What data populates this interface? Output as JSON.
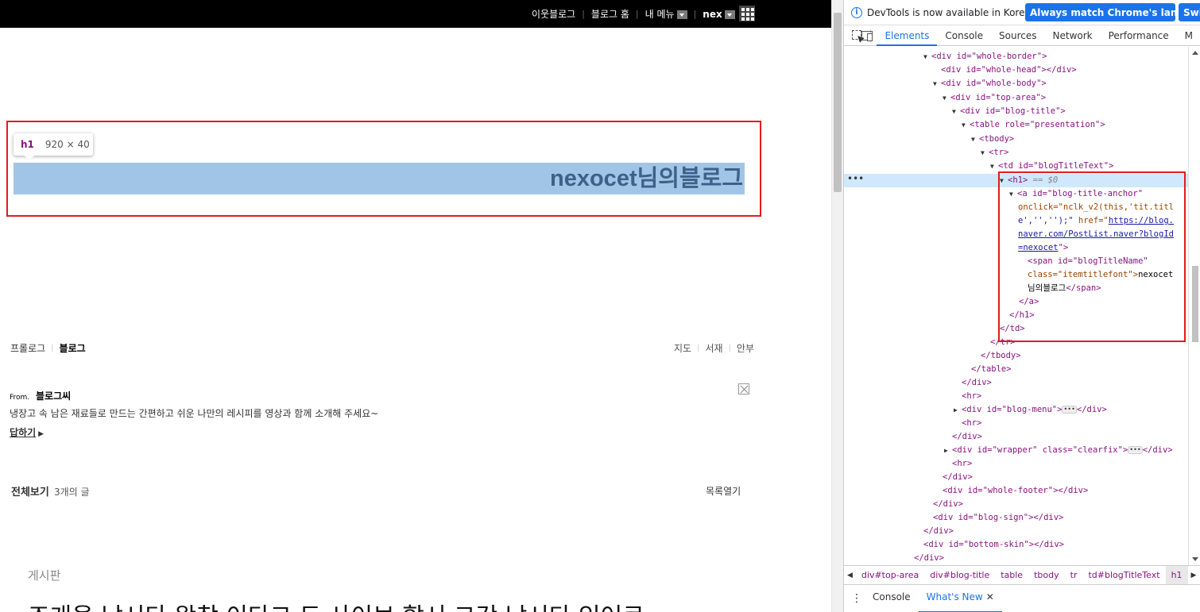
{
  "page": {
    "topbar": {
      "items": [
        "이웃블로그",
        "블로그 홈",
        "내 메뉴"
      ],
      "user": "nex"
    },
    "tooltip": {
      "tag": "h1",
      "dims": "920 × 40"
    },
    "blog_title": "nexocet님의블로그",
    "nav_left": [
      "프롤로그",
      "블로그"
    ],
    "nav_right": [
      "지도",
      "서재",
      "안부"
    ],
    "from": {
      "prefix": "From.",
      "name": "블로그씨",
      "text": "냉장고 속 남은 재료들로 만드는 간편하고 쉬운 나만의 레시피를 영상과 함께 소개해 주세요~",
      "reply": "답하기"
    },
    "list": {
      "all": "전체보기",
      "count": "3개의 글",
      "open": "목록열기"
    },
    "board_label": "게시판",
    "post_title": "조개을 남시다 왕창 이다그 도 사이브 할서 그갓 남시다 있어로"
  },
  "devtools": {
    "info_text": "DevTools is now available in Korean!",
    "btn_match": "Always match Chrome's language",
    "btn_switch": "Swit",
    "tabs": [
      "Elements",
      "Console",
      "Sources",
      "Network",
      "Performance",
      "M"
    ],
    "active_tab": "Elements",
    "crumbs": [
      "div#top-area",
      "div#blog-title",
      "table",
      "tbody",
      "tr",
      "td#blogTitleText",
      "h1"
    ],
    "drawer_tabs": [
      "Console",
      "What's New"
    ],
    "code": {
      "l1": "<div id=\"whole-border\">",
      "l2": "<div id=\"whole-head\"></div>",
      "l3": "<div id=\"whole-body\">",
      "l4": "<div id=\"top-area\">",
      "l5": "<div id=\"blog-title\">",
      "l6": "<table role=\"presentation\">",
      "l7": "<tbody>",
      "l8": "<tr>",
      "l9": "<td id=\"blogTitleText\">",
      "l10": "<h1>",
      "l10b": "== $0",
      "l11": "<a id=\"blog-title-anchor\"",
      "l12": "onclick=\"nclk_v2(this,'tit.titl",
      "l13a": "e','','');\"",
      "l13b": "href=\"",
      "l13c": "https://blog.",
      "l14": "naver.com/PostList.naver?blogId",
      "l15": "=nexocet",
      "l15b": "\">",
      "l16": "<span id=\"blogTitleName\"",
      "l17a": "class=\"itemtitlefont\">",
      "l17b": "nexocet",
      "l18a": "님의블로그",
      "l18b": "</span>",
      "l19": "</a>",
      "l20": "</h1>",
      "l21": "</td>",
      "l22": "</tr>",
      "l23": "</tbody>",
      "l24": "</table>",
      "l25": "</div>",
      "l26": "<hr>",
      "l27a": "<div id=\"blog-menu\">",
      "l27b": "</div>",
      "l28": "<hr>",
      "l29": "</div>",
      "l30a": "<div id=\"wrapper\" class=\"clearfix\">",
      "l30b": "</div>",
      "l31": "<hr>",
      "l32": "</div>",
      "l33": "<div id=\"whole-footer\"></div>",
      "l34": "</div>",
      "l35": "<div id=\"blog-sign\"></div>",
      "l36": "</div>",
      "l37": "<div id=\"bottom-skin\"></div>",
      "l38": "</div>"
    },
    "colors": {
      "accent": "#1a73e8",
      "highlight_box": "#e41b1b",
      "element_highlight": "#a1c5e6"
    }
  }
}
